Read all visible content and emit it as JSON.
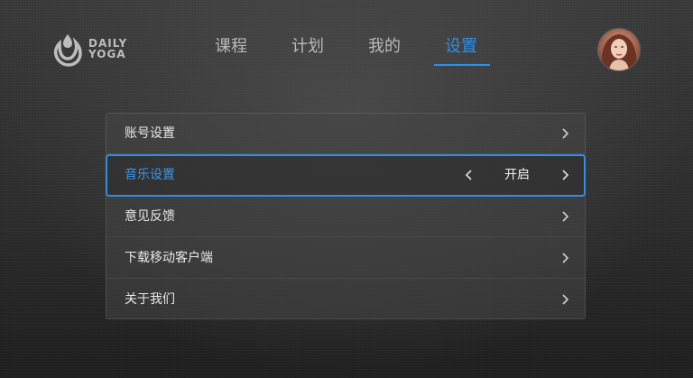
{
  "brand": {
    "line1": "DAILY",
    "line2": "YOGA",
    "logo_icon": "daily-yoga-logo-icon"
  },
  "nav": {
    "tabs": [
      {
        "label": "课程",
        "active": false
      },
      {
        "label": "计划",
        "active": false
      },
      {
        "label": "我的",
        "active": false
      },
      {
        "label": "设置",
        "active": true
      }
    ],
    "accent_color": "#2f8fe6"
  },
  "user": {
    "avatar_icon": "user-avatar"
  },
  "settings": {
    "items": [
      {
        "label": "账号设置",
        "icon_right": "chevron-right-icon"
      },
      {
        "label": "音乐设置",
        "value": "开启",
        "icon_left": "chevron-left-icon",
        "icon_right": "chevron-right-icon",
        "focused": true
      },
      {
        "label": "意见反馈",
        "icon_right": "chevron-right-icon"
      },
      {
        "label": "下载移动客户端",
        "icon_right": "chevron-right-icon"
      },
      {
        "label": "关于我们",
        "icon_right": "chevron-right-icon"
      }
    ]
  }
}
